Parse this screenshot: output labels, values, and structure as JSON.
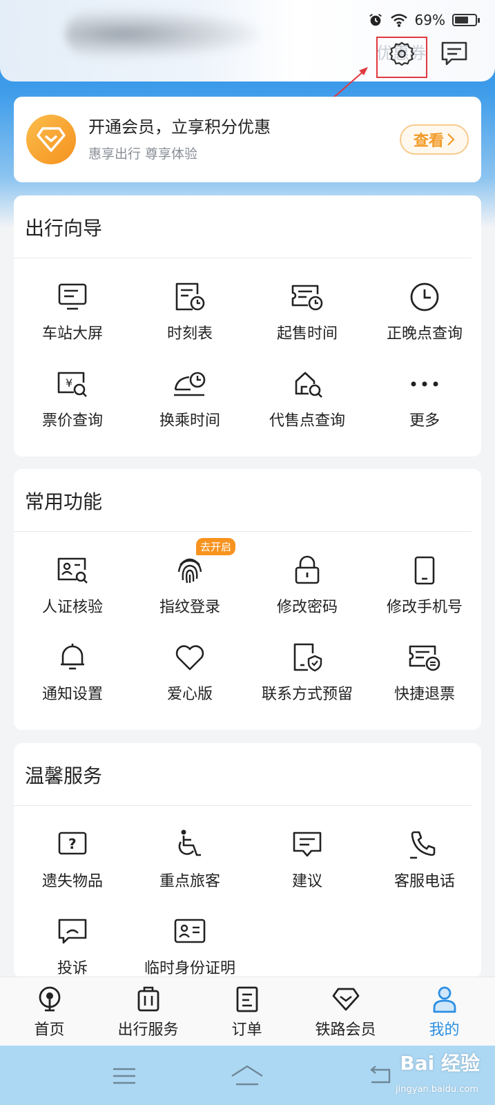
{
  "status_bar": {
    "battery": "69%"
  },
  "header": {
    "coupon_ghost": "优惠券",
    "settings_icon": "gear-icon",
    "message_icon": "message-icon"
  },
  "member_card": {
    "title": "开通会员，立享积分优惠",
    "subtitle": "惠享出行 尊享体验",
    "button": "查看",
    "accent": "#f29a26"
  },
  "travel_guide": {
    "title": "出行向导",
    "items": [
      {
        "label": "车站大屏",
        "icon": "monitor-icon"
      },
      {
        "label": "时刻表",
        "icon": "timetable-icon"
      },
      {
        "label": "起售时间",
        "icon": "ticket-clock-icon"
      },
      {
        "label": "正晚点查询",
        "icon": "clock-icon"
      },
      {
        "label": "票价查询",
        "icon": "price-search-icon"
      },
      {
        "label": "换乘时间",
        "icon": "transfer-icon"
      },
      {
        "label": "代售点查询",
        "icon": "agency-search-icon"
      },
      {
        "label": "更多",
        "icon": "more-icon"
      }
    ]
  },
  "common_functions": {
    "title": "常用功能",
    "badge": "去开启",
    "items": [
      {
        "label": "人证核验",
        "icon": "id-verify-icon"
      },
      {
        "label": "指纹登录",
        "icon": "fingerprint-icon"
      },
      {
        "label": "修改密码",
        "icon": "lock-icon"
      },
      {
        "label": "修改手机号",
        "icon": "phone-icon"
      },
      {
        "label": "通知设置",
        "icon": "bell-icon"
      },
      {
        "label": "爱心版",
        "icon": "heart-icon"
      },
      {
        "label": "联系方式预留",
        "icon": "contact-shield-icon"
      },
      {
        "label": "快捷退票",
        "icon": "refund-icon"
      }
    ]
  },
  "warm_service": {
    "title": "温馨服务",
    "items": [
      {
        "label": "遗失物品",
        "icon": "lost-items-icon"
      },
      {
        "label": "重点旅客",
        "icon": "wheelchair-icon"
      },
      {
        "label": "建议",
        "icon": "suggestion-icon"
      },
      {
        "label": "客服电话",
        "icon": "phone-call-icon"
      },
      {
        "label": "投诉",
        "icon": "complaint-icon"
      },
      {
        "label": "临时身份证明",
        "icon": "id-card-icon"
      }
    ]
  },
  "tabbar": {
    "items": [
      {
        "label": "首页",
        "icon": "home-train-icon"
      },
      {
        "label": "出行服务",
        "icon": "luggage-icon"
      },
      {
        "label": "订单",
        "icon": "order-icon"
      },
      {
        "label": "铁路会员",
        "icon": "diamond-icon"
      },
      {
        "label": "我的",
        "icon": "user-icon"
      }
    ],
    "active_color": "#2b8fe3"
  },
  "watermark": {
    "main": "Bai 经验",
    "sub": "jingyan.baidu.com"
  }
}
